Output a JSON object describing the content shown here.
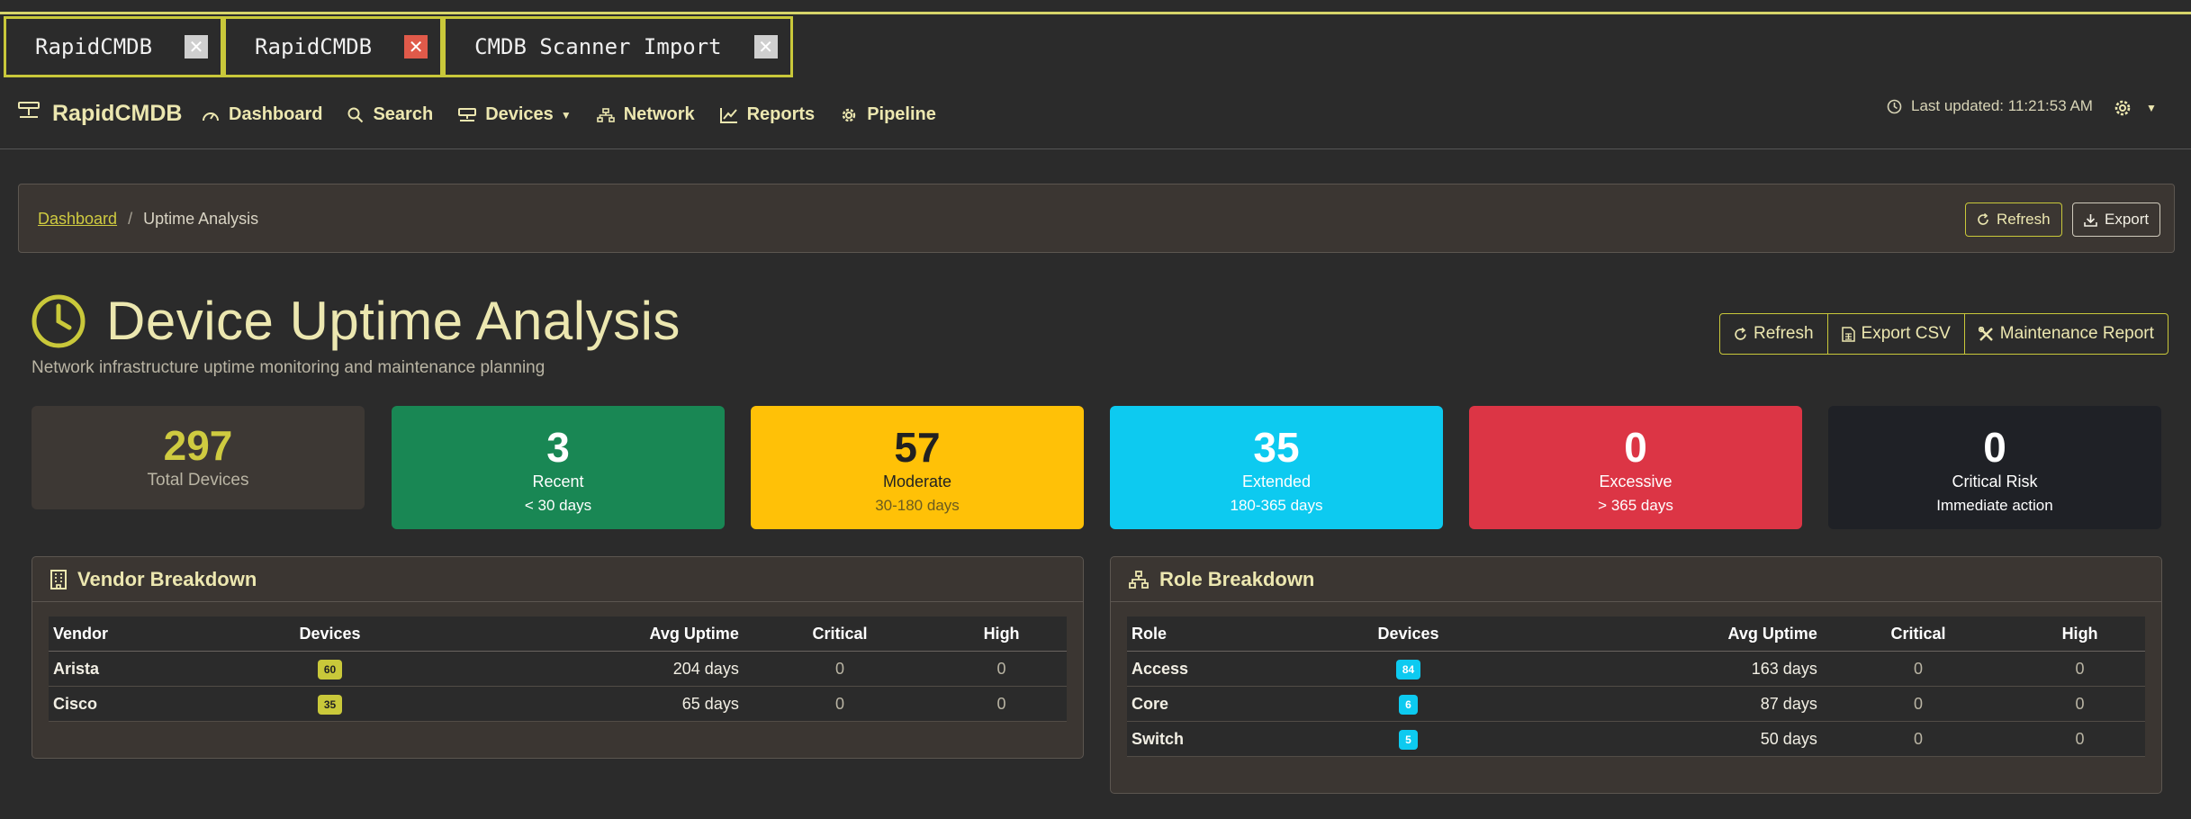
{
  "tabs": [
    {
      "label": "RapidCMDB",
      "close": "✕"
    },
    {
      "label": "RapidCMDB",
      "close": "✕"
    },
    {
      "label": "CMDB Scanner Import",
      "close": "✕"
    }
  ],
  "navbar": {
    "brand": "RapidCMDB",
    "items": [
      {
        "label": "Dashboard",
        "icon": "gauge-icon"
      },
      {
        "label": "Search",
        "icon": "search-icon"
      },
      {
        "label": "Devices",
        "icon": "hdd-network-icon"
      },
      {
        "label": "Network",
        "icon": "diagram-icon"
      },
      {
        "label": "Reports",
        "icon": "graph-up-icon"
      },
      {
        "label": "Pipeline",
        "icon": "gear-icon"
      }
    ],
    "last_updated": "Last updated: 11:21:53 AM"
  },
  "breadcrumb": {
    "home": "Dashboard",
    "separator": "/",
    "current": "Uptime Analysis",
    "refresh_label": "Refresh",
    "export_label": "Export"
  },
  "header": {
    "title": "Device Uptime Analysis",
    "subtitle": "Network infrastructure uptime monitoring and maintenance planning",
    "actions": {
      "refresh": "Refresh",
      "export_csv": "Export CSV",
      "maintenance_report": "Maintenance Report"
    }
  },
  "stats": {
    "total": {
      "value": "297",
      "label": "Total Devices"
    },
    "recent": {
      "value": "3",
      "label": "Recent",
      "sub": "< 30 days"
    },
    "moderate": {
      "value": "57",
      "label": "Moderate",
      "sub": "30-180 days"
    },
    "extended": {
      "value": "35",
      "label": "Extended",
      "sub": "180-365 days"
    },
    "excessive": {
      "value": "0",
      "label": "Excessive",
      "sub": "> 365 days"
    },
    "critical": {
      "value": "0",
      "label": "Critical Risk",
      "sub": "Immediate action"
    }
  },
  "vendor": {
    "title": "Vendor Breakdown",
    "headers": [
      "Vendor",
      "Devices",
      "Avg Uptime",
      "Critical",
      "High"
    ],
    "rows": [
      {
        "name": "Arista",
        "devices": "60",
        "avg": "204 days",
        "critical": "0",
        "high": "0"
      },
      {
        "name": "Cisco",
        "devices": "35",
        "avg": "65 days",
        "critical": "0",
        "high": "0"
      }
    ]
  },
  "role": {
    "title": "Role Breakdown",
    "headers": [
      "Role",
      "Devices",
      "Avg Uptime",
      "Critical",
      "High"
    ],
    "rows": [
      {
        "name": "Access",
        "devices": "84",
        "avg": "163 days",
        "critical": "0",
        "high": "0"
      },
      {
        "name": "Core",
        "devices": "6",
        "avg": "87 days",
        "critical": "0",
        "high": "0"
      },
      {
        "name": "Switch",
        "devices": "5",
        "avg": "50 days",
        "critical": "0",
        "high": "0"
      }
    ]
  },
  "colors": {
    "accent": "#c9c83a",
    "success": "#198754",
    "warning": "#ffc107",
    "info": "#0dcaf0",
    "danger": "#dc3545",
    "dark": "#1f2126"
  }
}
